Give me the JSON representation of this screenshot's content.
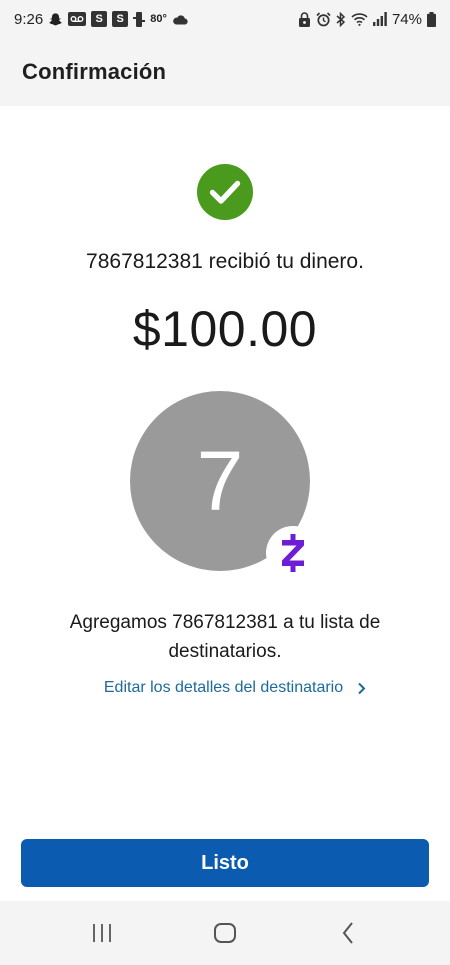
{
  "status_bar": {
    "time": "9:26",
    "temperature": "80°",
    "box_1": "S",
    "box_2": "S",
    "battery": "74%",
    "icons_left": [
      "snapchat-icon",
      "voicemail-icon",
      "s-box-icon",
      "s-box-icon",
      "signal-box-icon",
      "cloud-icon"
    ],
    "icons_right": [
      "lock-icon",
      "alarm-icon",
      "bluetooth-icon",
      "wifi-icon",
      "signal-icon",
      "battery-icon"
    ]
  },
  "header": {
    "title": "Confirmación"
  },
  "confirmation": {
    "recipient_received": "7867812381 recibió tu dinero.",
    "amount": "$100.00",
    "avatar_initial": "7",
    "added_message": "Agregamos 7867812381 a tu lista de destinatarios.",
    "edit_link": "Editar los detalles del destinatario"
  },
  "actions": {
    "done_label": "Listo"
  },
  "nav": {
    "items": [
      "recent-apps-icon",
      "home-icon",
      "back-icon"
    ]
  },
  "colors": {
    "success": "#4a9a1e",
    "primary": "#0b5cb0",
    "link": "#1d6a9b",
    "zelle": "#6d1ed4",
    "avatar": "#9a9a9a"
  }
}
